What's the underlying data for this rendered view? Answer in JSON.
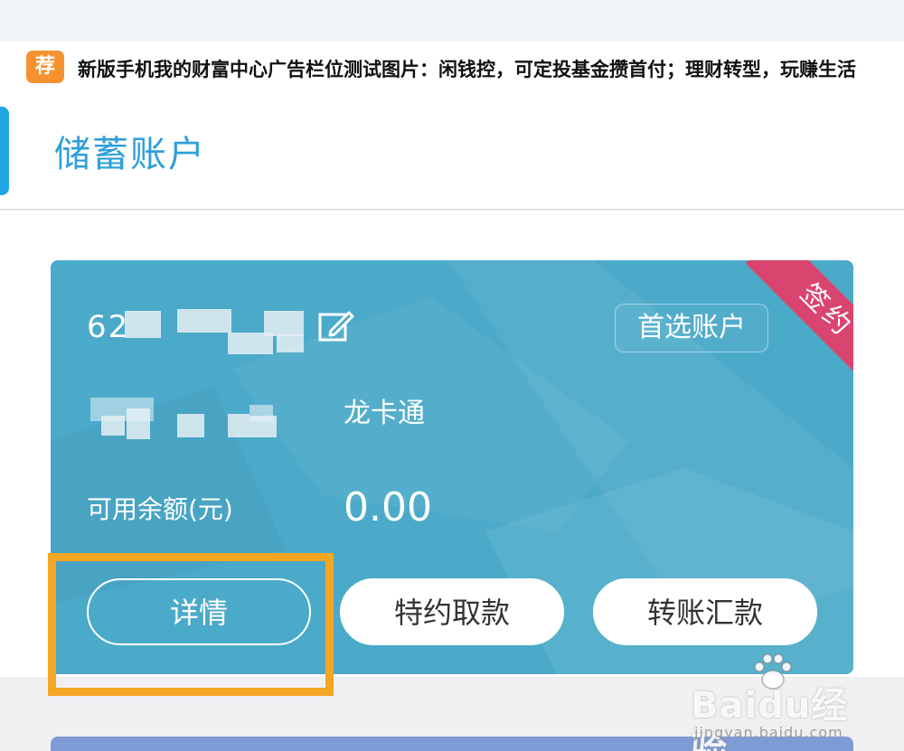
{
  "ad": {
    "badge": "荐",
    "text": "新版手机我的财富中心广告栏位测试图片：闲钱控，可定投基金攒首付；理财转型，玩赚生活"
  },
  "section": {
    "title": "储蓄账户"
  },
  "card": {
    "ribbon": "签约",
    "account_prefix": "62",
    "preferred_label": "首选账户",
    "card_type": "龙卡通",
    "balance_label": "可用余额(元)",
    "balance_value": "0.00"
  },
  "actions": {
    "details": "详情",
    "special_withdrawal": "特约取款",
    "transfer": "转账汇款"
  },
  "watermark": {
    "brand": "Baidu经验",
    "url": "jingyan.baidu.com"
  },
  "colors": {
    "card_bg": "#4baac9",
    "accent_blue": "#2f9fd8",
    "ribbon_red": "#d9456f",
    "highlight_orange": "#f5a623",
    "badge_orange": "#f5922f"
  }
}
